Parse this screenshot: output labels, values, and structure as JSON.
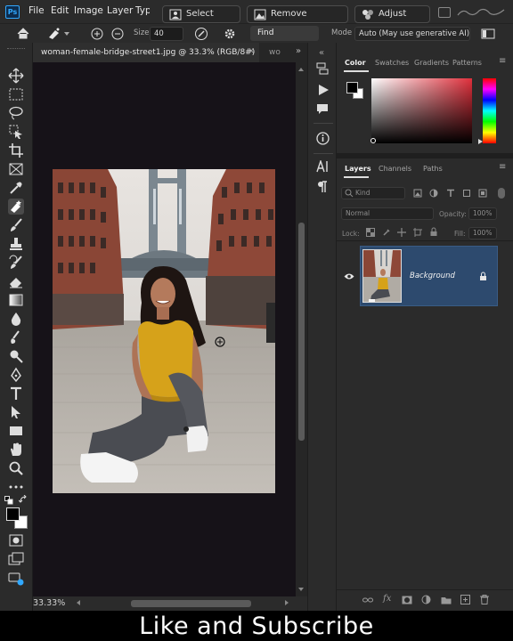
{
  "app": {
    "logo_text": "Ps"
  },
  "menu": {
    "items": [
      "File",
      "Edit",
      "Image",
      "Layer",
      "Typ"
    ]
  },
  "contextual_task_bar": {
    "select_subject": "Select subject",
    "remove_background": "Remove background",
    "adjust_colors": "Adjust colors"
  },
  "options_bar": {
    "size_label": "Size",
    "size_value": "40",
    "find_distractions": "Find distractions",
    "mode_label": "Mode",
    "mode_value": "Auto (May use generative AI)"
  },
  "document": {
    "tab_title": "woman-female-bridge-street1.jpg @ 33.3% (RGB/8#)",
    "second_tab": "wo",
    "zoom": "33.33%"
  },
  "color_panel": {
    "tabs": [
      "Color",
      "Swatches",
      "Gradients",
      "Patterns"
    ],
    "active_tab": "Color",
    "hue_color": "#e0303c",
    "foreground_color": "#000000",
    "background_color": "#ffffff"
  },
  "layers_panel": {
    "tabs": [
      "Layers",
      "Channels",
      "Paths"
    ],
    "active_tab": "Layers",
    "kind_placeholder": "Kind",
    "blend_mode": "Normal",
    "opacity_label": "Opacity:",
    "opacity_value": "100%",
    "lock_label": "Lock:",
    "fill_label": "Fill:",
    "fill_value": "100%",
    "layers": [
      {
        "name": "Background",
        "visible": true,
        "locked": true
      }
    ]
  },
  "caption": "Like and Subscribe",
  "colors": {
    "accent_blue": "#31a8ff",
    "selected_layer": "#2d4a6e",
    "panel_bg": "#2b2b2b",
    "canvas_bg": "#161218"
  }
}
